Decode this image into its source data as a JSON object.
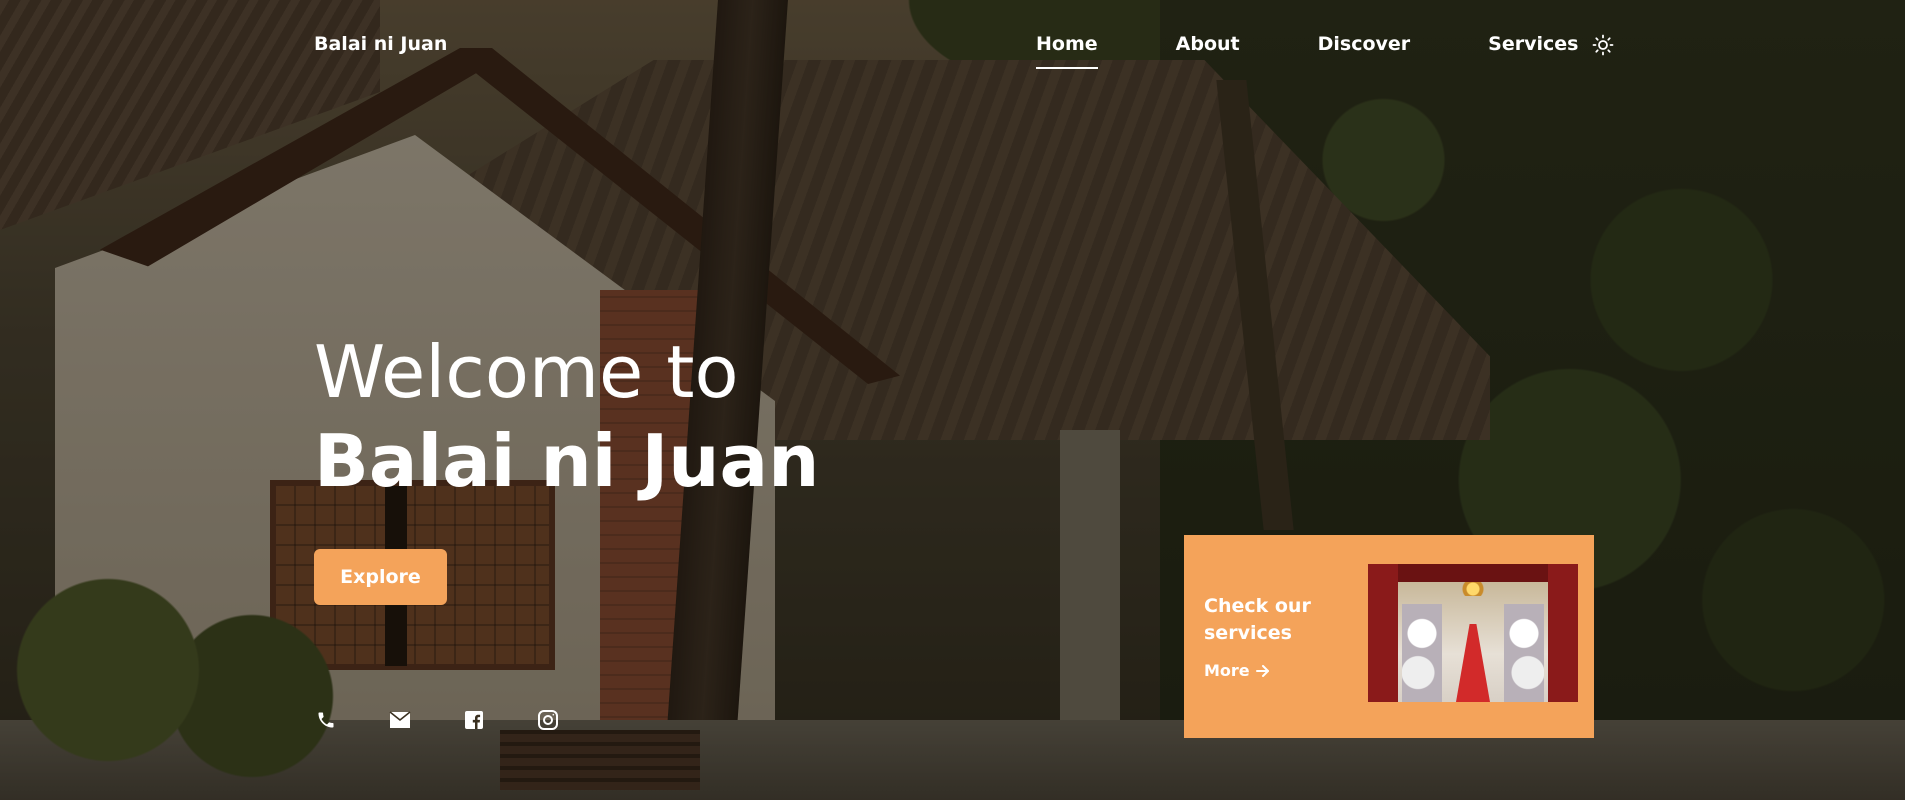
{
  "header": {
    "brand": "Balai ni Juan",
    "nav": [
      {
        "label": "Home",
        "active": true
      },
      {
        "label": "About",
        "active": false
      },
      {
        "label": "Discover",
        "active": false
      },
      {
        "label": "Services",
        "active": false
      }
    ],
    "theme_toggle_icon": "sun-icon"
  },
  "hero": {
    "line1": "Welcome to",
    "line2": "Balai ni Juan",
    "explore_label": "Explore"
  },
  "socials": [
    {
      "icon": "phone-icon"
    },
    {
      "icon": "mail-icon"
    },
    {
      "icon": "facebook-icon"
    },
    {
      "icon": "instagram-icon"
    }
  ],
  "services_card": {
    "title": "Check our services",
    "more_label": "More",
    "more_icon": "arrow-right-icon",
    "image": "wedding-hall-image"
  },
  "colors": {
    "accent": "#f4a35a",
    "text": "#ffffff"
  }
}
